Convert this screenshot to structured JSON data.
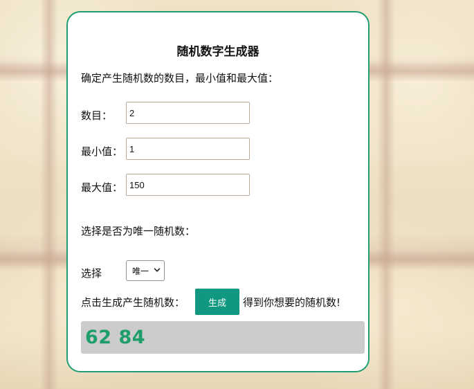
{
  "card": {
    "title": "随机数字生成器",
    "instruction": "确定产生随机数的数目，最小值和最大值：",
    "count": {
      "label": "数目：",
      "value": "2"
    },
    "min": {
      "label": "最小值：",
      "value": "1"
    },
    "max": {
      "label": "最大值：",
      "value": "150"
    },
    "unique_prompt": "选择是否为唯一随机数：",
    "choice": {
      "label": "选择",
      "selected": "唯一",
      "icon": "chevron-down-icon"
    },
    "generate": {
      "prefix": "点击生成产生随机数：",
      "button_label": "生成",
      "suffix": "得到你想要的随机数!"
    },
    "result": "62 84"
  },
  "colors": {
    "border": "#1e9e72",
    "button": "#109880",
    "result_text": "#1e9e6a",
    "result_bg": "#cccccc"
  }
}
